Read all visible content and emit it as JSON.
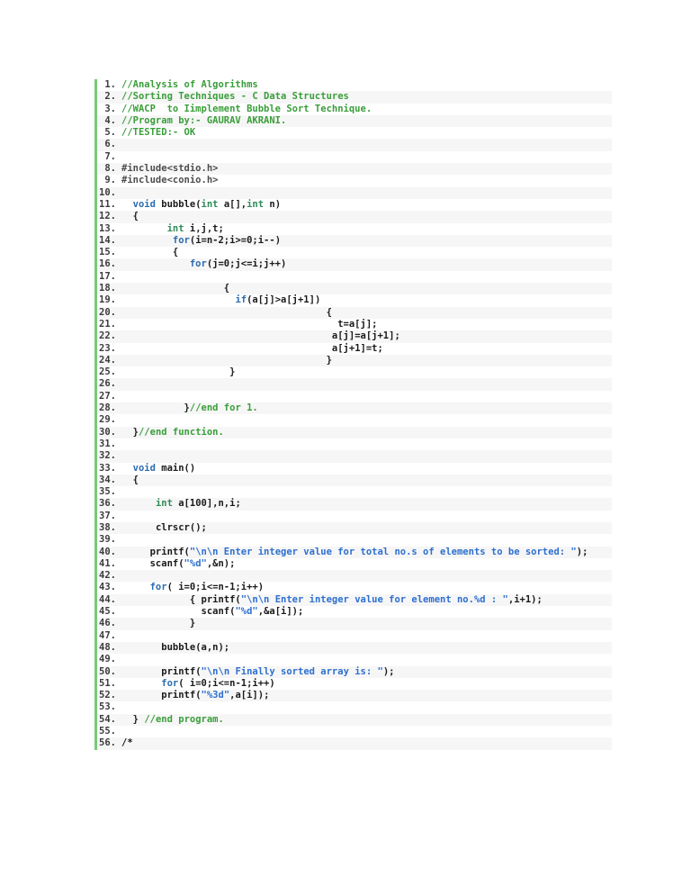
{
  "document": {
    "background": "#ffffff",
    "code_block": {
      "accent_bar_color": "#79c979",
      "stripe_color": "#f6f6f6",
      "syntax_colors": {
        "line_number": "#3c3c3c",
        "plain": "#1a1a1a",
        "comment": "#3a9e3a",
        "keyword": "#2b6cb0",
        "type": "#2e8b57",
        "string": "#2e6fd0",
        "preprocessor": "#4d4d4d"
      },
      "lines": [
        {
          "num": "1.",
          "indent": 0,
          "tokens": [
            [
              "comment",
              "//Analysis of Algorithms"
            ]
          ]
        },
        {
          "num": "2.",
          "indent": 0,
          "tokens": [
            [
              "comment",
              "//Sorting Techniques - C Data Structures"
            ]
          ]
        },
        {
          "num": "3.",
          "indent": 0,
          "tokens": [
            [
              "comment",
              "//WACP  to Iimplement Bubble Sort Technique."
            ]
          ]
        },
        {
          "num": "4.",
          "indent": 0,
          "tokens": [
            [
              "comment",
              "//Program by:- GAURAV AKRANI."
            ]
          ]
        },
        {
          "num": "5.",
          "indent": 0,
          "tokens": [
            [
              "comment",
              "//TESTED:- OK"
            ]
          ]
        },
        {
          "num": "6.",
          "indent": 0,
          "tokens": []
        },
        {
          "num": "7.",
          "indent": 0,
          "tokens": []
        },
        {
          "num": "8.",
          "indent": 0,
          "tokens": [
            [
              "preprocessor",
              "#include<stdio.h>"
            ]
          ]
        },
        {
          "num": "9.",
          "indent": 0,
          "tokens": [
            [
              "preprocessor",
              "#include<conio.h>"
            ]
          ]
        },
        {
          "num": "10.",
          "indent": 0,
          "tokens": []
        },
        {
          "num": "11.",
          "indent": 2,
          "tokens": [
            [
              "keyword",
              "void"
            ],
            [
              "plain",
              " bubble("
            ],
            [
              "type",
              "int"
            ],
            [
              "plain",
              " a[],"
            ],
            [
              "type",
              "int"
            ],
            [
              "plain",
              " n)"
            ]
          ]
        },
        {
          "num": "12.",
          "indent": 2,
          "tokens": [
            [
              "plain",
              "{"
            ]
          ]
        },
        {
          "num": "13.",
          "indent": 8,
          "tokens": [
            [
              "type",
              "int"
            ],
            [
              "plain",
              " i,j,t;"
            ]
          ]
        },
        {
          "num": "14.",
          "indent": 9,
          "tokens": [
            [
              "keyword",
              "for"
            ],
            [
              "plain",
              "(i=n-2;i>=0;i--)"
            ]
          ]
        },
        {
          "num": "15.",
          "indent": 9,
          "tokens": [
            [
              "plain",
              "{"
            ]
          ]
        },
        {
          "num": "16.",
          "indent": 12,
          "tokens": [
            [
              "keyword",
              "for"
            ],
            [
              "plain",
              "(j=0;j<=i;j++)"
            ]
          ]
        },
        {
          "num": "17.",
          "indent": 0,
          "tokens": []
        },
        {
          "num": "18.",
          "indent": 18,
          "tokens": [
            [
              "plain",
              "{"
            ]
          ]
        },
        {
          "num": "19.",
          "indent": 20,
          "tokens": [
            [
              "keyword",
              "if"
            ],
            [
              "plain",
              "(a[j]>a[j+1])"
            ]
          ]
        },
        {
          "num": "20.",
          "indent": 36,
          "tokens": [
            [
              "plain",
              "{"
            ]
          ]
        },
        {
          "num": "21.",
          "indent": 38,
          "tokens": [
            [
              "plain",
              "t=a[j];"
            ]
          ]
        },
        {
          "num": "22.",
          "indent": 37,
          "tokens": [
            [
              "plain",
              "a[j]=a[j+1];"
            ]
          ]
        },
        {
          "num": "23.",
          "indent": 37,
          "tokens": [
            [
              "plain",
              "a[j+1]=t;"
            ]
          ]
        },
        {
          "num": "24.",
          "indent": 36,
          "tokens": [
            [
              "plain",
              "}"
            ]
          ]
        },
        {
          "num": "25.",
          "indent": 19,
          "tokens": [
            [
              "plain",
              "}"
            ]
          ]
        },
        {
          "num": "26.",
          "indent": 0,
          "tokens": []
        },
        {
          "num": "27.",
          "indent": 0,
          "tokens": []
        },
        {
          "num": "28.",
          "indent": 11,
          "tokens": [
            [
              "plain",
              "}"
            ],
            [
              "comment",
              "//end for 1."
            ]
          ]
        },
        {
          "num": "29.",
          "indent": 0,
          "tokens": []
        },
        {
          "num": "30.",
          "indent": 2,
          "tokens": [
            [
              "plain",
              "}"
            ],
            [
              "comment",
              "//end function."
            ]
          ]
        },
        {
          "num": "31.",
          "indent": 0,
          "tokens": []
        },
        {
          "num": "32.",
          "indent": 0,
          "tokens": []
        },
        {
          "num": "33.",
          "indent": 2,
          "tokens": [
            [
              "keyword",
              "void"
            ],
            [
              "plain",
              " main()"
            ]
          ]
        },
        {
          "num": "34.",
          "indent": 2,
          "tokens": [
            [
              "plain",
              "{"
            ]
          ]
        },
        {
          "num": "35.",
          "indent": 0,
          "tokens": []
        },
        {
          "num": "36.",
          "indent": 6,
          "tokens": [
            [
              "type",
              "int"
            ],
            [
              "plain",
              " a[100],n,i;"
            ]
          ]
        },
        {
          "num": "37.",
          "indent": 0,
          "tokens": []
        },
        {
          "num": "38.",
          "indent": 6,
          "tokens": [
            [
              "plain",
              "clrscr();"
            ]
          ]
        },
        {
          "num": "39.",
          "indent": 0,
          "tokens": []
        },
        {
          "num": "40.",
          "indent": 5,
          "tokens": [
            [
              "plain",
              "printf("
            ],
            [
              "string",
              "\"\\n\\n Enter integer value for total no.s of elements to be sorted: \""
            ],
            [
              "plain",
              ");"
            ]
          ]
        },
        {
          "num": "41.",
          "indent": 5,
          "tokens": [
            [
              "plain",
              "scanf("
            ],
            [
              "string",
              "\"%d\""
            ],
            [
              "plain",
              ",&n);"
            ]
          ]
        },
        {
          "num": "42.",
          "indent": 0,
          "tokens": []
        },
        {
          "num": "43.",
          "indent": 5,
          "tokens": [
            [
              "keyword",
              "for"
            ],
            [
              "plain",
              "( i=0;i<=n-1;i++)"
            ]
          ]
        },
        {
          "num": "44.",
          "indent": 12,
          "tokens": [
            [
              "plain",
              "{ printf("
            ],
            [
              "string",
              "\"\\n\\n Enter integer value for element no.%d : \""
            ],
            [
              "plain",
              ",i+1);"
            ]
          ]
        },
        {
          "num": "45.",
          "indent": 14,
          "tokens": [
            [
              "plain",
              "scanf("
            ],
            [
              "string",
              "\"%d\""
            ],
            [
              "plain",
              ",&a[i]);"
            ]
          ]
        },
        {
          "num": "46.",
          "indent": 12,
          "tokens": [
            [
              "plain",
              "}"
            ]
          ]
        },
        {
          "num": "47.",
          "indent": 0,
          "tokens": []
        },
        {
          "num": "48.",
          "indent": 7,
          "tokens": [
            [
              "plain",
              "bubble(a,n);"
            ]
          ]
        },
        {
          "num": "49.",
          "indent": 0,
          "tokens": []
        },
        {
          "num": "50.",
          "indent": 7,
          "tokens": [
            [
              "plain",
              "printf("
            ],
            [
              "string",
              "\"\\n\\n Finally sorted array is: \""
            ],
            [
              "plain",
              ");"
            ]
          ]
        },
        {
          "num": "51.",
          "indent": 7,
          "tokens": [
            [
              "keyword",
              "for"
            ],
            [
              "plain",
              "( i=0;i<=n-1;i++)"
            ]
          ]
        },
        {
          "num": "52.",
          "indent": 7,
          "tokens": [
            [
              "plain",
              "printf("
            ],
            [
              "string",
              "\"%3d\""
            ],
            [
              "plain",
              ",a[i]);"
            ]
          ]
        },
        {
          "num": "53.",
          "indent": 0,
          "tokens": []
        },
        {
          "num": "54.",
          "indent": 2,
          "tokens": [
            [
              "plain",
              "} "
            ],
            [
              "comment",
              "//end program."
            ]
          ]
        },
        {
          "num": "55.",
          "indent": 0,
          "tokens": []
        },
        {
          "num": "56.",
          "indent": 0,
          "tokens": [
            [
              "plain",
              "/*"
            ]
          ]
        }
      ]
    }
  }
}
